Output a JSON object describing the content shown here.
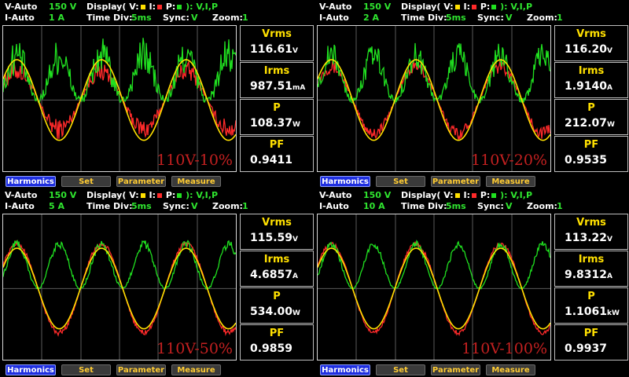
{
  "colors": {
    "voltage": "#ffe000",
    "current": "#ff2a2a",
    "power": "#20e020",
    "grid": "#5a5a5a",
    "label": "#c32020"
  },
  "common": {
    "display_prefix": "Display(",
    "v_key": "V:",
    "i_key": "I:",
    "p_key": "P:",
    "display_suffix": "): V,I,P",
    "time_div_label": "Time Div:",
    "time_div": "5ms",
    "sync_label": "Sync:",
    "sync": "V",
    "zoom_label": "Zoom:",
    "zoom": "1",
    "meas_titles": {
      "vrms": "Vrms",
      "irms": "Irms",
      "p": "P",
      "pf": "PF"
    },
    "buttons": {
      "harmonics": "Harmonics",
      "set": "Set",
      "parameter": "Parameter",
      "measure": "Measure"
    }
  },
  "panels": [
    {
      "v_range_label": "V-Auto",
      "v_range": "150 V",
      "i_range_label": "I-Auto",
      "i_range": "1 A",
      "vrms": "116.61",
      "vrms_unit": "V",
      "irms": "987.51",
      "irms_unit": "mA",
      "p": "108.37",
      "p_unit": "W",
      "pf": "0.9411",
      "label": "110V-10%",
      "current_ratio": 0.66,
      "power_noise": 0.34,
      "current_noise": 0.22
    },
    {
      "v_range_label": "V-Auto",
      "v_range": "150 V",
      "i_range_label": "I-Auto",
      "i_range": "2 A",
      "vrms": "116.20",
      "vrms_unit": "V",
      "irms": "1.9140",
      "irms_unit": "A",
      "p": "212.07",
      "p_unit": "W",
      "pf": "0.9535",
      "label": "110V-20%",
      "current_ratio": 0.75,
      "power_noise": 0.25,
      "current_noise": 0.14
    },
    {
      "v_range_label": "V-Auto",
      "v_range": "150 V",
      "i_range_label": "I-Auto",
      "i_range": "5 A",
      "vrms": "115.59",
      "vrms_unit": "V",
      "irms": "4.6857",
      "irms_unit": "A",
      "p": "534.00",
      "p_unit": "W",
      "pf": "0.9859",
      "label": "110V-50%",
      "current_ratio": 1.0,
      "power_noise": 0.08,
      "current_noise": 0.06
    },
    {
      "v_range_label": "V-Auto",
      "v_range": "150 V",
      "i_range_label": "I-Auto",
      "i_range": "10 A",
      "vrms": "113.22",
      "vrms_unit": "V",
      "irms": "9.8312",
      "irms_unit": "A",
      "p": "1.1061",
      "p_unit": "kW",
      "pf": "0.9937",
      "label": "110V-100%",
      "current_ratio": 1.0,
      "power_noise": 0.06,
      "current_noise": 0.05
    }
  ]
}
